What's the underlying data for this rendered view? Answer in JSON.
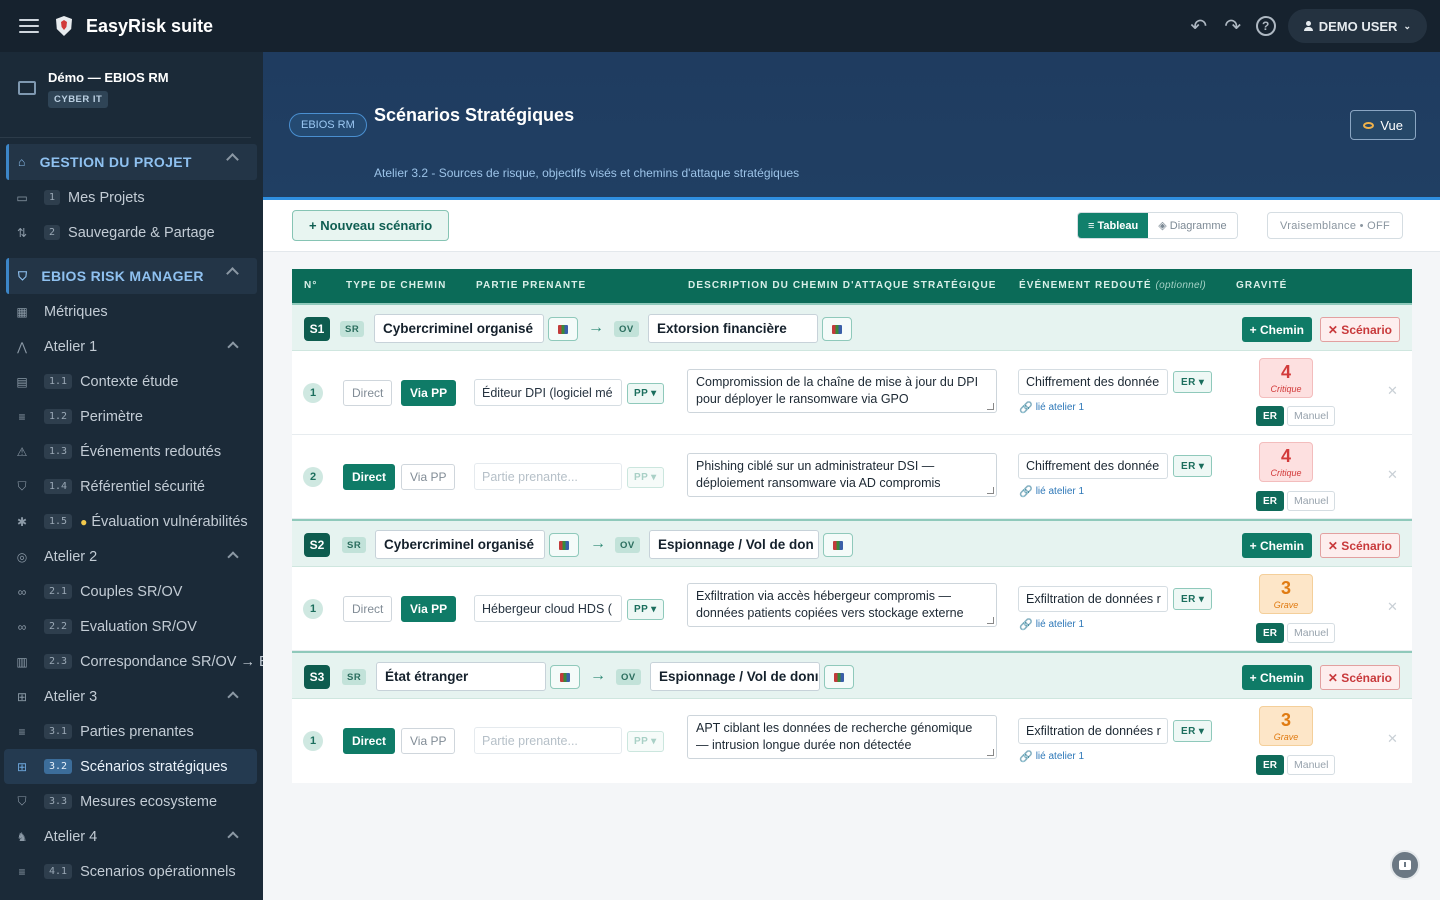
{
  "app": {
    "title": "EasyRisk suite",
    "user": "DEMO USER"
  },
  "project": {
    "name": "Démo — EBIOS RM",
    "badge": "CYBER IT"
  },
  "sidebar": {
    "section1": "GESTION DU PROJET",
    "s1_items": [
      {
        "num": "1",
        "label": "Mes Projets"
      },
      {
        "num": "2",
        "label": "Sauvegarde & Partage"
      }
    ],
    "section2": "EBIOS RISK MANAGER",
    "metriques": "Métriques",
    "atelier1": "Atelier 1",
    "a1_items": [
      {
        "num": "1.1",
        "label": "Contexte étude"
      },
      {
        "num": "1.2",
        "label": "Perimètre"
      },
      {
        "num": "1.3",
        "label": "Événements redoutés"
      },
      {
        "num": "1.4",
        "label": "Référentiel sécurité"
      },
      {
        "num": "1.5",
        "label": "Évaluation vulnérabilités"
      }
    ],
    "atelier2": "Atelier 2",
    "a2_items": [
      {
        "num": "2.1",
        "label": "Couples SR/OV"
      },
      {
        "num": "2.2",
        "label": "Evaluation SR/OV"
      },
      {
        "num": "2.3",
        "label": "Correspondance SR/OV → EF"
      }
    ],
    "atelier3": "Atelier 3",
    "a3_items": [
      {
        "num": "3.1",
        "label": "Parties prenantes"
      },
      {
        "num": "3.2",
        "label": "Scénarios stratégiques"
      },
      {
        "num": "3.3",
        "label": "Mesures ecosysteme"
      }
    ],
    "atelier4": "Atelier 4",
    "a4_items": [
      {
        "num": "4.1",
        "label": "Scenarios opérationnels"
      }
    ]
  },
  "header": {
    "pill": "EBIOS RM",
    "title": "Scénarios Stratégiques",
    "subtitle": "Atelier 3.2 - Sources de risque, objectifs visés et chemins d'attaque stratégiques",
    "vue_label": "Vue"
  },
  "toolbar": {
    "new_scenario": "+ Nouveau scénario",
    "view_table": "≡ Tableau",
    "view_diagram": "◈ Diagramme",
    "vraisemblance": "Vraisemblance • OFF"
  },
  "table": {
    "headers": {
      "num": "N°",
      "type": "TYPE DE CHEMIN",
      "partie": "PARTIE PRENANTE",
      "desc": "DESCRIPTION DU CHEMIN D'ATTAQUE STRATÉGIQUE",
      "event": "ÉVÉNEMENT REDOUTÉ",
      "event_opt": "(optionnel)",
      "gravite": "GRAVITÉ"
    },
    "labels": {
      "sr": "SR",
      "ov": "OV",
      "direct": "Direct",
      "via_pp": "Via PP",
      "pp": "PP ▾",
      "er": "ER ▾",
      "er_badge": "ER",
      "manuel": "Manuel",
      "lie": "lié atelier 1",
      "add_chemin": "+ Chemin",
      "del_scenario": "✕ Scénario",
      "pp_placeholder": "Partie prenante..."
    },
    "scenarios": [
      {
        "id": "S1",
        "sr": "Cybercriminel organisé",
        "ov": "Extorsion financière",
        "rows": [
          {
            "n": "1",
            "type": "via",
            "pp": "Éditeur DPI (logiciel mé",
            "desc": "Compromission de la chaîne de mise à jour du DPI pour déployer le ransomware via GPO",
            "er": "Chiffrement des donnée",
            "grav": "4",
            "grav_label": "Critique"
          },
          {
            "n": "2",
            "type": "direct",
            "pp": "",
            "desc": "Phishing ciblé sur un administrateur DSI — déploiement ransomware via AD compromis",
            "er": "Chiffrement des donnée",
            "grav": "4",
            "grav_label": "Critique"
          }
        ]
      },
      {
        "id": "S2",
        "sr": "Cybercriminel organisé",
        "ov": "Espionnage / Vol de don",
        "rows": [
          {
            "n": "1",
            "type": "via",
            "pp": "Hébergeur cloud HDS (",
            "desc": "Exfiltration via accès hébergeur compromis — données patients copiées vers stockage externe",
            "er": "Exfiltration de données r",
            "grav": "3",
            "grav_label": "Grave"
          }
        ]
      },
      {
        "id": "S3",
        "sr": "État étranger",
        "ov": "Espionnage / Vol de donı",
        "rows": [
          {
            "n": "1",
            "type": "direct",
            "pp": "",
            "desc": "APT ciblant les données de recherche génomique — intrusion longue durée non détectée",
            "er": "Exfiltration de données r",
            "grav": "3",
            "grav_label": "Grave"
          }
        ]
      }
    ]
  }
}
